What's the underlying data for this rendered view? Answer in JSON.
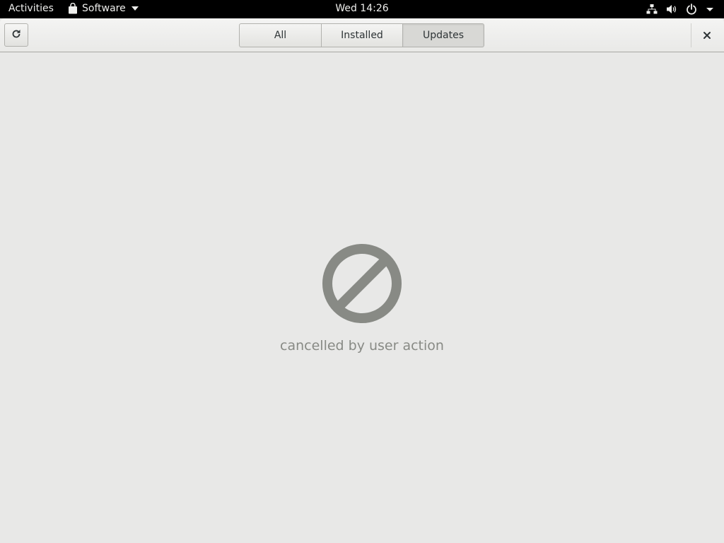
{
  "topbar": {
    "activities_label": "Activities",
    "app_name": "Software",
    "clock": "Wed 14:26",
    "icons": [
      "network-icon",
      "volume-icon",
      "power-icon",
      "chevron-down-icon"
    ]
  },
  "headerbar": {
    "refresh_icon": "refresh-icon",
    "tabs": [
      {
        "label": "All",
        "active": false
      },
      {
        "label": "Installed",
        "active": false
      },
      {
        "label": "Updates",
        "active": true
      }
    ],
    "close_icon": "close-icon"
  },
  "main": {
    "status_icon": "blocked-icon",
    "message": "cancelled by user action"
  },
  "colors": {
    "topbar_bg": "#000000",
    "content_bg": "#e8e8e7",
    "status_icon": "#888a85",
    "message_text": "#888a85"
  }
}
